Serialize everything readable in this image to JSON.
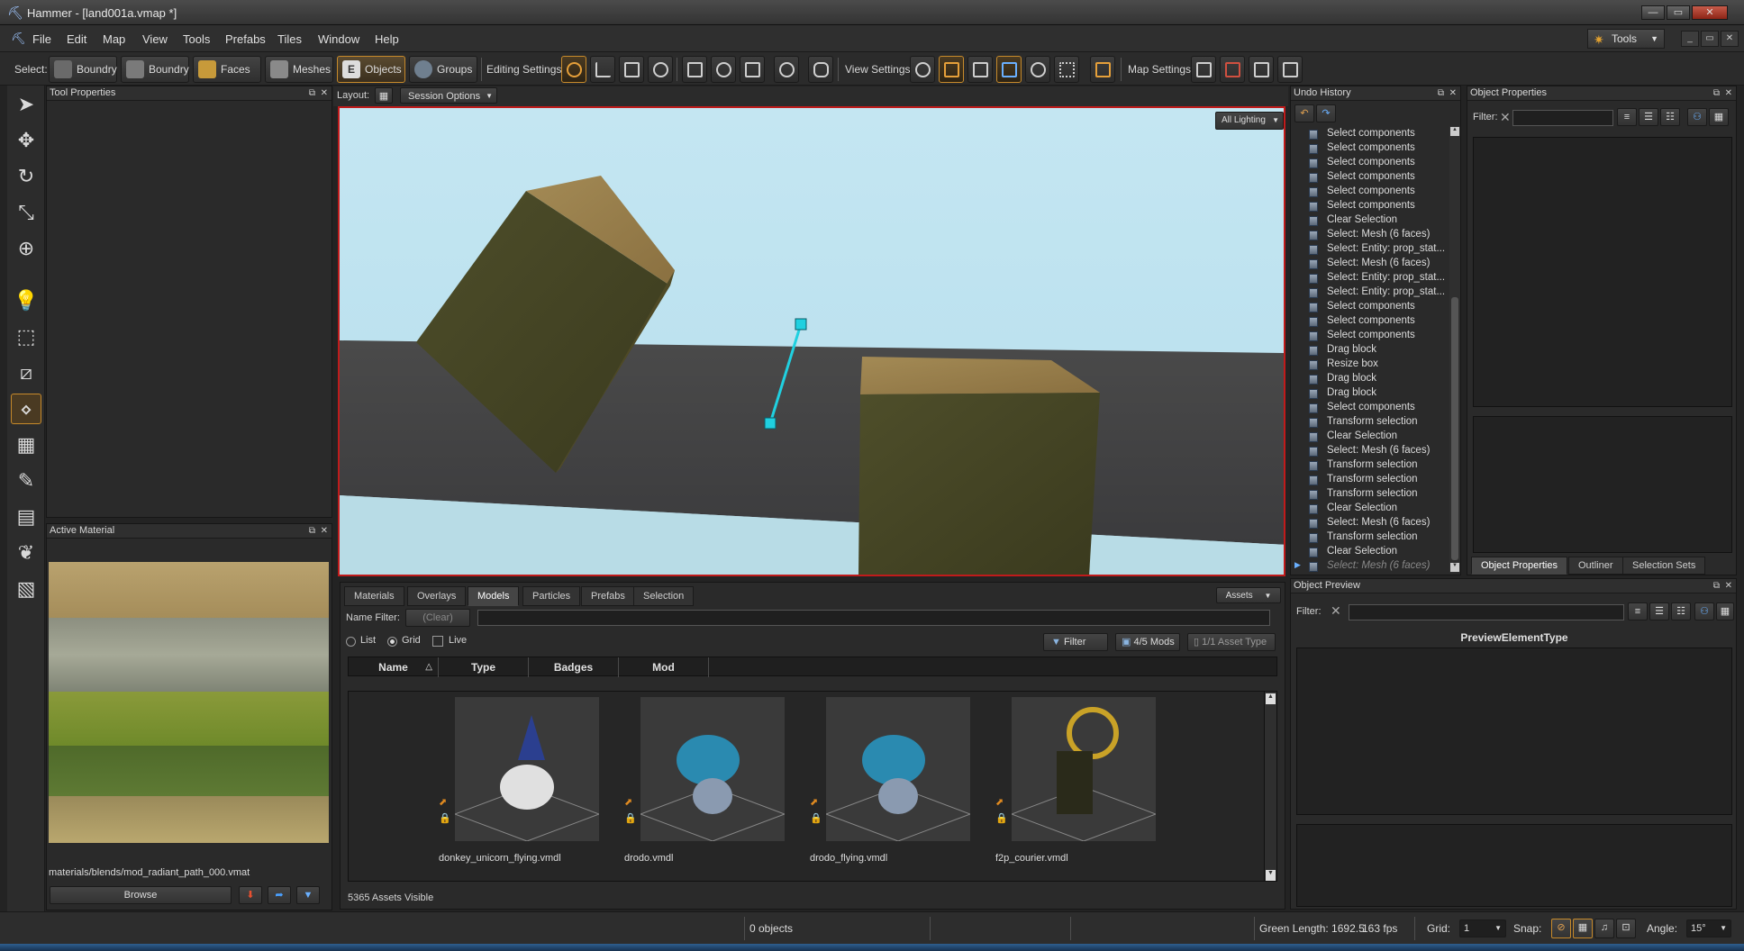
{
  "window": {
    "title": "Hammer - [land001a.vmap *]",
    "minimize": "—",
    "maximize": "▭",
    "close": "✕"
  },
  "menu": {
    "items": [
      "File",
      "Edit",
      "Map",
      "View",
      "Tools",
      "Prefabs",
      "Tiles",
      "Window",
      "Help"
    ],
    "tools_button": "Tools"
  },
  "toolbar": {
    "select_label": "Select:",
    "select_buttons": [
      "Boundry",
      "Boundry",
      "Faces",
      "Meshes",
      "Objects",
      "Groups"
    ],
    "editing_label": "Editing Settings:",
    "view_label": "View Settings:",
    "map_label": "Map Settings:"
  },
  "tool_properties": {
    "title": "Tool Properties"
  },
  "active_material": {
    "title": "Active Material",
    "path": "materials/blends/mod_radiant_path_000.vmat",
    "browse_label": "Browse"
  },
  "layout_bar": {
    "layout_label": "Layout:",
    "session_options": "Session Options"
  },
  "viewport": {
    "lighting_mode": "All Lighting"
  },
  "asset_browser": {
    "tabs": [
      "Materials",
      "Overlays",
      "Models",
      "Particles",
      "Prefabs",
      "Selection"
    ],
    "active_tab": "Models",
    "assets_dropdown": "Assets",
    "name_filter_label": "Name Filter:",
    "clear_label": "(Clear)",
    "view_options": [
      "List",
      "Grid",
      "Live"
    ],
    "view_selected": "Grid",
    "filter_button": "Filter",
    "mods_button": "4/5 Mods",
    "asset_type_button": "1/1 Asset Type",
    "columns": [
      "Name",
      "Type",
      "Badges",
      "Mod"
    ],
    "assets": [
      {
        "name": "donkey_unicorn_flying.vmdl"
      },
      {
        "name": "drodo.vmdl"
      },
      {
        "name": "drodo_flying.vmdl"
      },
      {
        "name": "f2p_courier.vmdl"
      }
    ],
    "footer": "5365 Assets Visible"
  },
  "undo_history": {
    "title": "Undo History",
    "items": [
      "Select components",
      "Select components",
      "Select components",
      "Select components",
      "Select components",
      "Select components",
      "Clear Selection",
      "Select: Mesh (6 faces)",
      "Select: Entity: prop_stat...",
      "Select: Mesh (6 faces)",
      "Select: Entity: prop_stat...",
      "Select: Entity: prop_stat...",
      "Select components",
      "Select components",
      "Select components",
      "Drag block",
      "Resize box",
      "Drag block",
      "Drag block",
      "Select components",
      "Transform selection",
      "Clear Selection",
      "Select: Mesh (6 faces)",
      "Transform selection",
      "Transform selection",
      "Transform selection",
      "Clear Selection",
      "Select: Mesh (6 faces)",
      "Transform selection",
      "Clear Selection",
      "Select: Mesh (6 faces)"
    ]
  },
  "object_properties": {
    "title": "Object Properties",
    "filter_label": "Filter:",
    "tabs": [
      "Object Properties",
      "Outliner",
      "Selection Sets"
    ]
  },
  "object_preview": {
    "title": "Object Preview",
    "filter_label": "Filter:",
    "preview_type": "PreviewElementType"
  },
  "statusbar": {
    "objects": "0 objects",
    "green_length": "Green Length: 1692.5",
    "fps": "163 fps",
    "grid_label": "Grid:",
    "grid_value": "1",
    "snap_label": "Snap:",
    "angle_label": "Angle:",
    "angle_value": "15°"
  },
  "colors": {
    "accent": "#c78a2b",
    "viewport_border": "#c01b1b",
    "sky": "#bfe3f0",
    "gizmo": "#20d0e0"
  }
}
